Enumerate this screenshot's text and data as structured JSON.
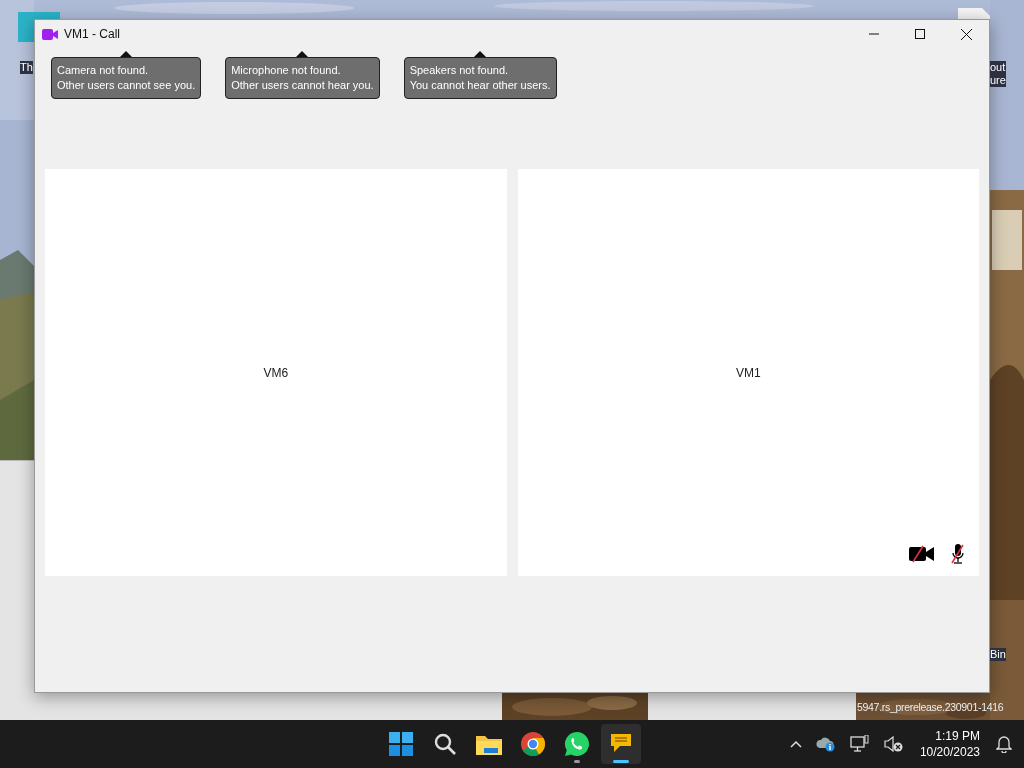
{
  "desktop": {
    "kind": "picture",
    "icon_labels": [
      {
        "text": "Th"
      },
      {
        "text": "out\nure"
      },
      {
        "text": "Bin"
      }
    ],
    "watermark": "5947.rs_prerelease.230901-1416"
  },
  "window": {
    "title": "VM1 - Call"
  },
  "notices": [
    {
      "line1": "Camera not found.",
      "line2": "Other users cannot see you."
    },
    {
      "line1": "Microphone not found.",
      "line2": "Other users cannot hear you."
    },
    {
      "line1": "Speakers not found.",
      "line2": "You cannot hear other users."
    }
  ],
  "participants": [
    {
      "name": "VM6",
      "camera_muted": false,
      "mic_muted": false
    },
    {
      "name": "VM1",
      "camera_muted": true,
      "mic_muted": true
    }
  ],
  "taskbar": {
    "apps": [
      {
        "kind": "start",
        "running": false,
        "selected": false
      },
      {
        "kind": "search",
        "running": false,
        "selected": false
      },
      {
        "kind": "folder",
        "running": false,
        "selected": false
      },
      {
        "kind": "browser",
        "running": false,
        "selected": false
      },
      {
        "kind": "whatsapp",
        "running": true,
        "selected": false
      },
      {
        "kind": "chat",
        "running": true,
        "selected": true
      }
    ],
    "time": "1:19 PM",
    "date": "10/20/2023"
  }
}
